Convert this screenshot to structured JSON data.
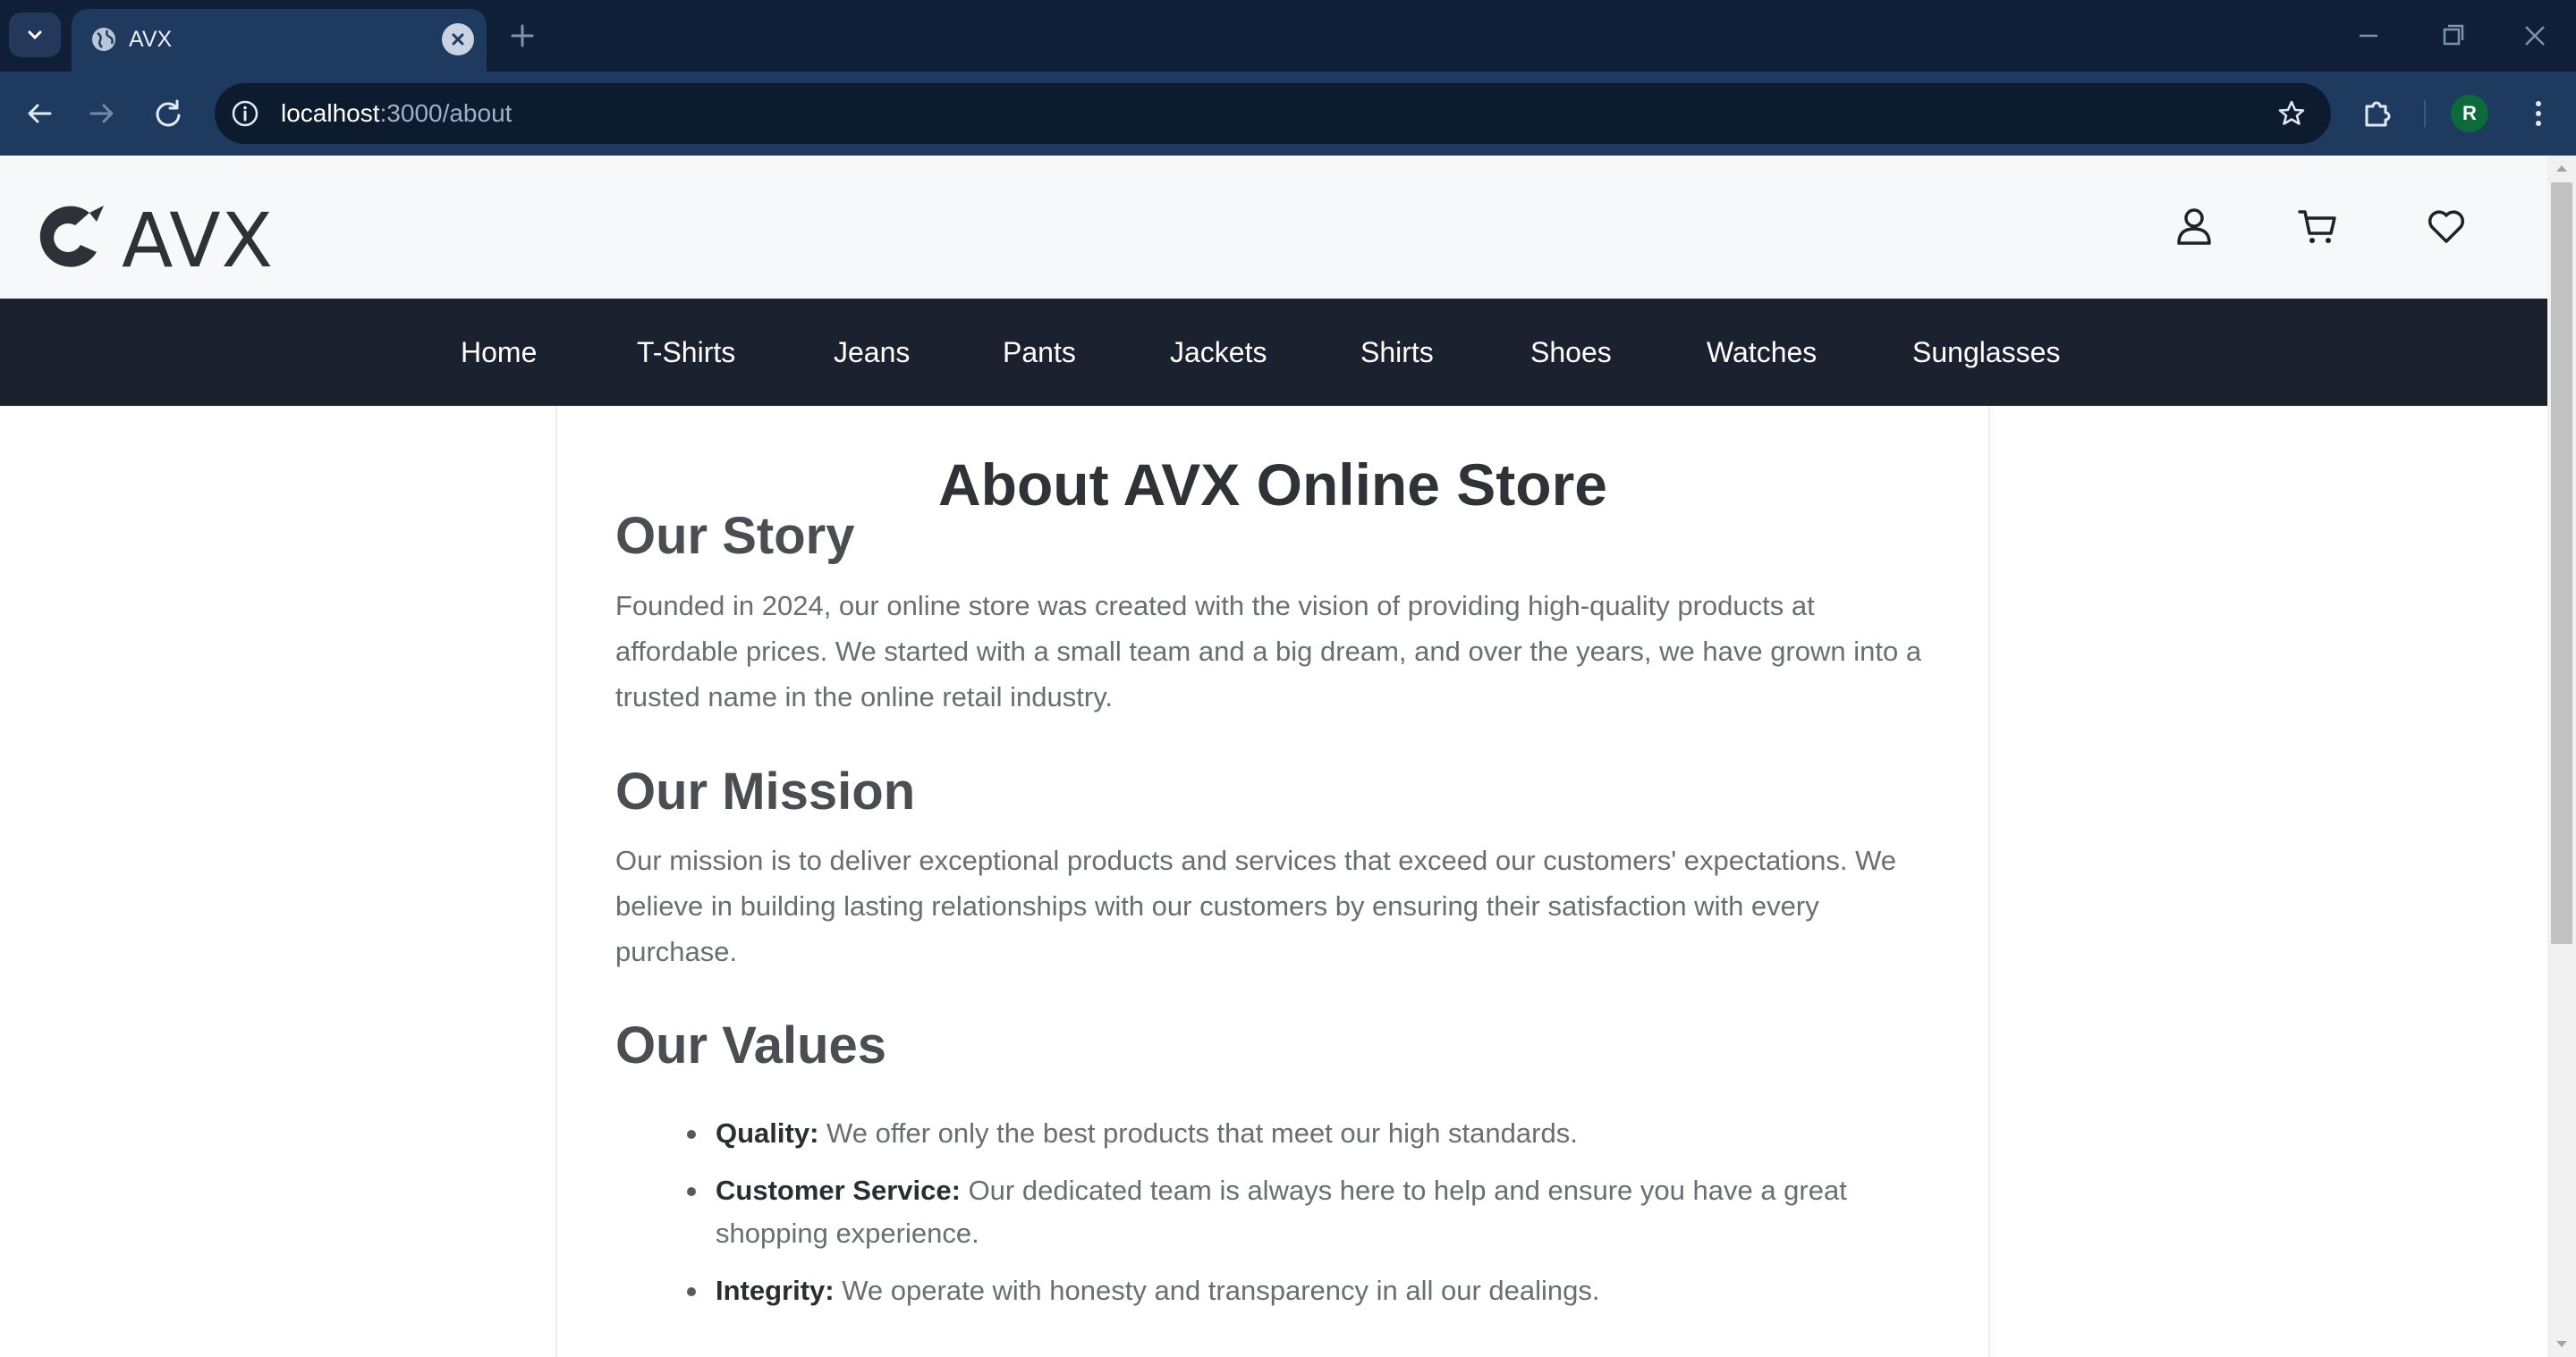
{
  "browser": {
    "tab_title": "AVX",
    "url_host": "localhost",
    "url_path": ":3000/about",
    "profile_initial": "R"
  },
  "site": {
    "logo_text": "AVX",
    "nav": [
      "Home",
      "T-Shirts",
      "Jeans",
      "Pants",
      "Jackets",
      "Shirts",
      "Shoes",
      "Watches",
      "Sunglasses"
    ]
  },
  "content": {
    "title": "About AVX Online Store",
    "story_heading": "Our Story",
    "story_text": "Founded in 2024, our online store was created with the vision of providing high-quality products at affordable prices. We started with a small team and a big dream, and over the years, we have grown into a trusted name in the online retail industry.",
    "mission_heading": "Our Mission",
    "mission_text": "Our mission is to deliver exceptional products and services that exceed our customers' expectations. We believe in building lasting relationships with our customers by ensuring their satisfaction with every purchase.",
    "values_heading": "Our Values",
    "values": [
      {
        "label": "Quality:",
        "text": " We offer only the best products that meet our high standards."
      },
      {
        "label": "Customer Service:",
        "text": " Our dedicated team is always here to help and ensure you have a great shopping experience."
      },
      {
        "label": "Integrity:",
        "text": " We operate with honesty and transparency in all our dealings."
      }
    ]
  },
  "colors": {
    "chrome_dark": "#0f1f38",
    "chrome_toolbar": "#1f3a5f",
    "nav_bar": "#1c2130",
    "header_bg": "#f7f8fa"
  },
  "icons": {
    "account": "user-icon",
    "cart": "cart-icon",
    "wishlist": "heart-icon"
  }
}
